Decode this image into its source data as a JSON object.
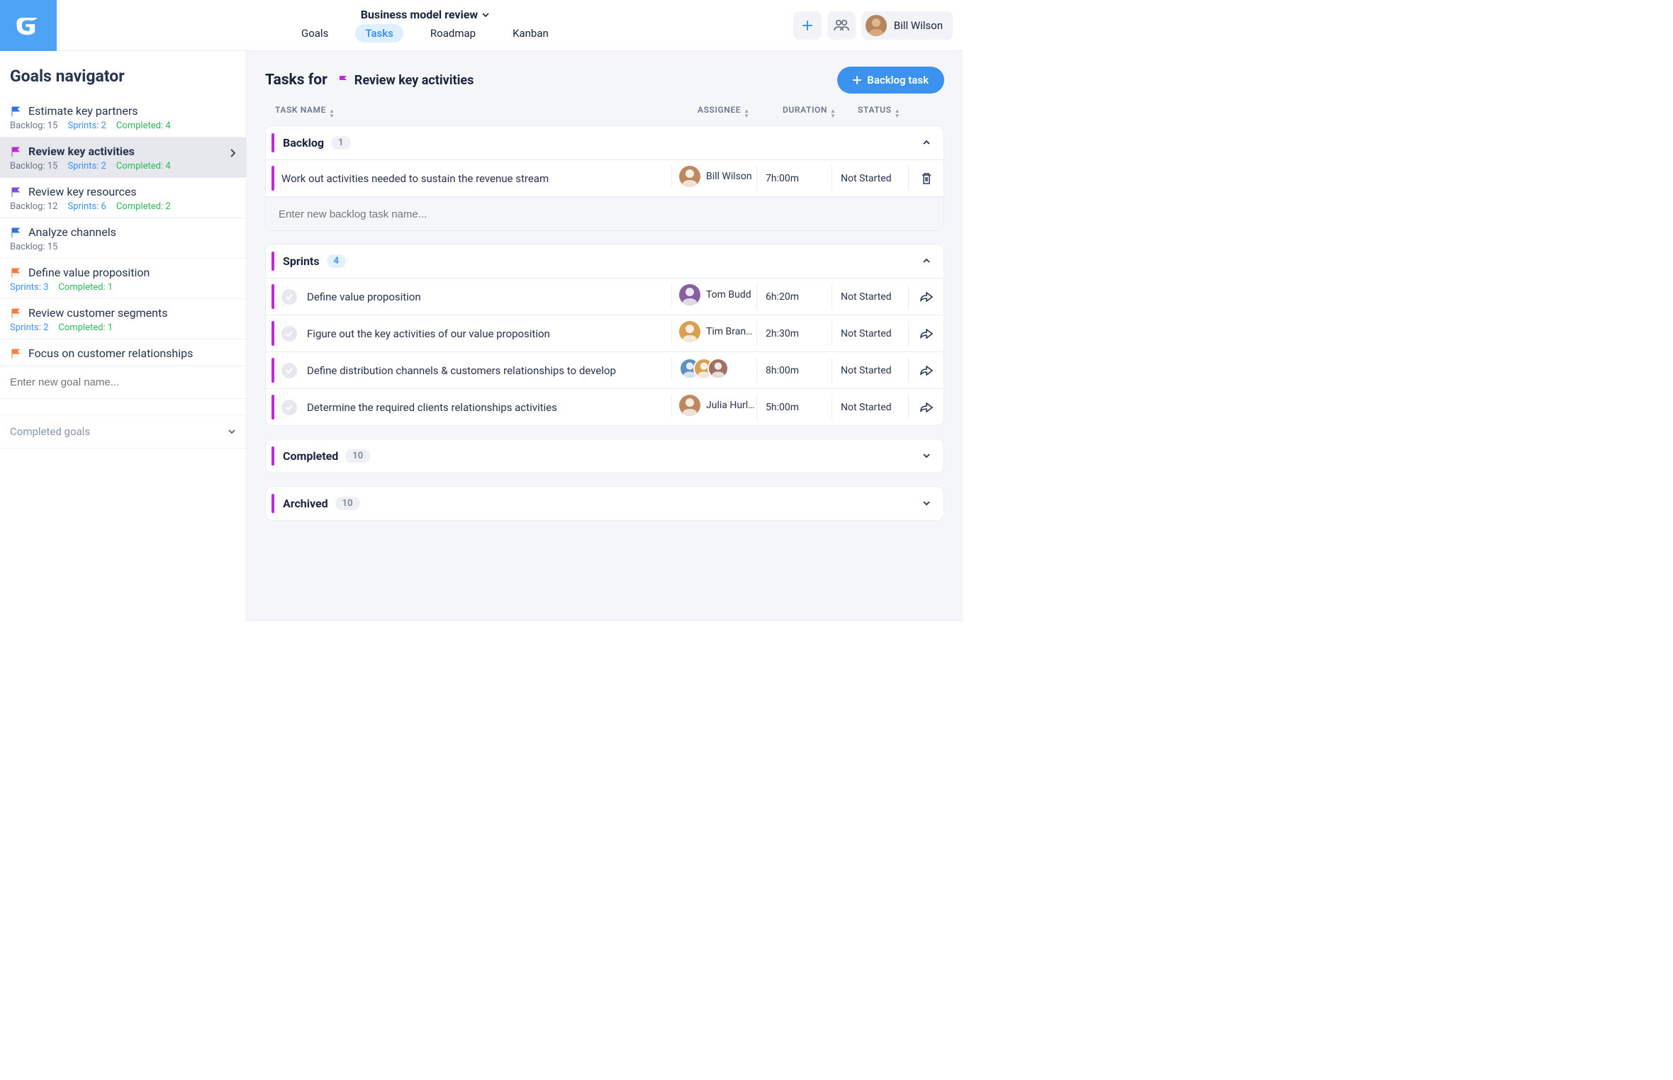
{
  "colors": {
    "brand_blue": "#4fa3f7",
    "primary": "#3b92ef",
    "magenta": "#c028d8",
    "orange": "#f57c3b",
    "violet": "#7c4de0",
    "blue_flag": "#2a74e6",
    "green": "#2fb85a",
    "link_blue": "#3b92ef",
    "muted": "#8b95a8"
  },
  "header": {
    "project_title": "Business model review",
    "tabs": {
      "goals": "Goals",
      "tasks": "Tasks",
      "roadmap": "Roadmap",
      "kanban": "Kanban"
    },
    "user_name": "Bill Wilson"
  },
  "sidebar": {
    "title": "Goals navigator",
    "new_goal_placeholder": "Enter new goal name...",
    "completed_label": "Completed goals",
    "items": [
      {
        "name": "Estimate key partners",
        "flag": "#2a74e6",
        "backlog": "Backlog: 15",
        "sprints": "Sprints: 2",
        "completed": "Completed: 4",
        "active": false
      },
      {
        "name": "Review key activities",
        "flag": "#c028d8",
        "backlog": "Backlog: 15",
        "sprints": "Sprints: 2",
        "completed": "Completed: 4",
        "active": true
      },
      {
        "name": "Review key resources",
        "flag": "#7c4de0",
        "backlog": "Backlog: 12",
        "sprints": "Sprints: 6",
        "completed": "Completed: 2",
        "active": false
      },
      {
        "name": "Analyze channels",
        "flag": "#2a74e6",
        "backlog": "Backlog: 15",
        "sprints": "",
        "completed": "",
        "active": false
      },
      {
        "name": "Define value proposition",
        "flag": "#f57c3b",
        "backlog": "",
        "sprints": "Sprints: 3",
        "completed": "Completed: 1",
        "active": false
      },
      {
        "name": "Review customer segments",
        "flag": "#f57c3b",
        "backlog": "",
        "sprints": "Sprints: 2",
        "completed": "Completed: 1",
        "active": false
      },
      {
        "name": "Focus on customer relationships",
        "flag": "#f57c3b",
        "backlog": "",
        "sprints": "",
        "completed": "",
        "active": false
      }
    ]
  },
  "main": {
    "title_prefix": "Tasks for",
    "goal_name": "Review key activities",
    "backlog_btn": "Backlog task",
    "columns": {
      "name": "TASK NAME",
      "assignee": "ASSIGNEE",
      "duration": "DURATION",
      "status": "STATUS"
    },
    "new_task_placeholder": "Enter new backlog task name...",
    "sections": {
      "backlog": {
        "title": "Backlog",
        "count": "1"
      },
      "sprints": {
        "title": "Sprints",
        "count": "4"
      },
      "completed": {
        "title": "Completed",
        "count": "10"
      },
      "archived": {
        "title": "Archived",
        "count": "10"
      }
    },
    "backlog_tasks": [
      {
        "name": "Work out activities needed to sustain the revenue stream",
        "assignee": "Bill Wilson",
        "duration": "7h:00m",
        "status": "Not Started"
      }
    ],
    "sprint_tasks": [
      {
        "name": "Define value proposition",
        "assignee": "Tom Budd",
        "duration": "6h:20m",
        "status": "Not Started"
      },
      {
        "name": "Figure out the key activities of our value proposition",
        "assignee": "Tim Bran…",
        "duration": "2h:30m",
        "status": "Not Started"
      },
      {
        "name": "Define distribution channels & customers relationships to develop",
        "assignee": "",
        "duration": "8h:00m",
        "status": "Not Started",
        "multi": true
      },
      {
        "name": "Determine the required clients relationships activities",
        "assignee": "Julia Hurley",
        "duration": "5h:00m",
        "status": "Not Started"
      }
    ]
  }
}
